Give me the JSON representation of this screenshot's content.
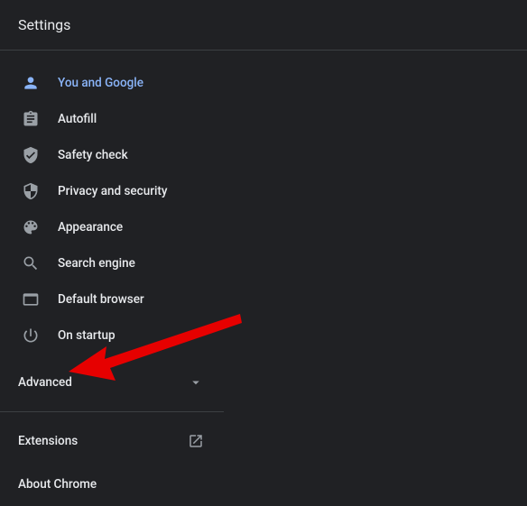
{
  "header": {
    "title": "Settings"
  },
  "sidebar": {
    "items": [
      {
        "label": "You and Google"
      },
      {
        "label": "Autofill"
      },
      {
        "label": "Safety check"
      },
      {
        "label": "Privacy and security"
      },
      {
        "label": "Appearance"
      },
      {
        "label": "Search engine"
      },
      {
        "label": "Default browser"
      },
      {
        "label": "On startup"
      }
    ],
    "advanced": {
      "label": "Advanced"
    },
    "extensions": {
      "label": "Extensions"
    },
    "about": {
      "label": "About Chrome"
    }
  }
}
